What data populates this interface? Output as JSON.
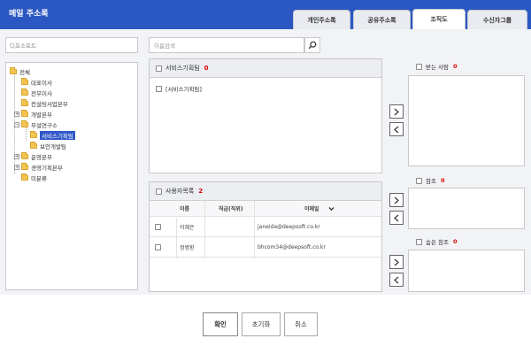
{
  "header": {
    "title": "메일 주소록"
  },
  "tabs": [
    {
      "label": "개인주소록",
      "active": false
    },
    {
      "label": "공유주소록",
      "active": false
    },
    {
      "label": "조직도",
      "active": true
    },
    {
      "label": "수신자그룹",
      "active": false
    }
  ],
  "left": {
    "dropdown_value": "디프소프트",
    "tree": [
      {
        "label": "전체",
        "level": 0,
        "expander": ""
      },
      {
        "label": "대표이사",
        "level": 1,
        "expander": ""
      },
      {
        "label": "전무이사",
        "level": 1,
        "expander": ""
      },
      {
        "label": "컨설팅사업본부",
        "level": 1,
        "expander": ""
      },
      {
        "label": "개발본부",
        "level": 1,
        "expander": "+"
      },
      {
        "label": "부설연구소",
        "level": 1,
        "expander": "−"
      },
      {
        "label": "서비스기획팀",
        "level": 2,
        "expander": "",
        "selected": true
      },
      {
        "label": "보안개발팀",
        "level": 2,
        "expander": ""
      },
      {
        "label": "운영본부",
        "level": 1,
        "expander": "+"
      },
      {
        "label": "경영기획본부",
        "level": 1,
        "expander": "+"
      },
      {
        "label": "미분류",
        "level": 1,
        "expander": ""
      }
    ]
  },
  "search": {
    "placeholder": "이름검색"
  },
  "dept_panel": {
    "title": "서비스기획팀",
    "count": "0",
    "items": [
      "[서비스기획팀]"
    ]
  },
  "user_panel": {
    "title": "사용자목록",
    "count": "2",
    "columns": {
      "name": "이름",
      "position": "직급(직위)",
      "email": "이메일"
    },
    "rows": [
      {
        "name": "이혜은",
        "position": "",
        "email": "janeida@deepsoft.co.kr"
      },
      {
        "name": "정병환",
        "position": "",
        "email": "bhcom34@deepsoft.co.kr"
      }
    ]
  },
  "recipients": {
    "to_label": "받는 사람",
    "to_count": "0",
    "cc_label": "참조",
    "cc_count": "0",
    "bcc_label": "숨은 참조",
    "bcc_count": "0"
  },
  "footer": {
    "confirm": "확인",
    "reset": "초기화",
    "cancel": "취소"
  },
  "colors": {
    "header_bg": "#2b57c2",
    "count_red": "#dd0000",
    "selected_bg": "#2f57c8"
  }
}
